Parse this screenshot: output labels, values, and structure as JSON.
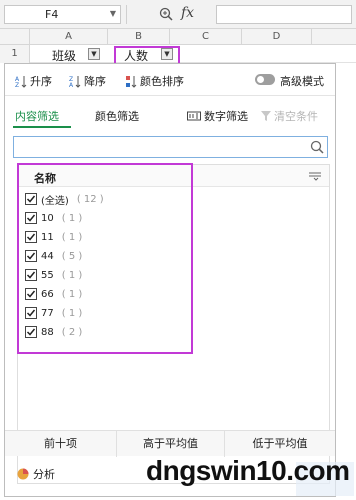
{
  "formula_bar": {
    "cell_ref": "F4",
    "fx": "fx"
  },
  "columns": [
    "A",
    "B",
    "C",
    "D"
  ],
  "row1": {
    "number": "1",
    "a": "班级",
    "b": "人数"
  },
  "sort": {
    "asc": "升序",
    "desc": "降序",
    "color_sort": "颜色排序",
    "advanced": "高级模式"
  },
  "tabs": {
    "content": "内容筛选",
    "color": "颜色筛选",
    "number": "数字筛选",
    "clear": "清空条件"
  },
  "search": {
    "placeholder": ""
  },
  "list": {
    "title": "名称",
    "items": [
      {
        "label": "(全选)",
        "count": "( 12 )",
        "checked": true
      },
      {
        "label": "10",
        "count": "( 1 )",
        "checked": true
      },
      {
        "label": "11",
        "count": "( 1 )",
        "checked": true
      },
      {
        "label": "44",
        "count": "( 5 )",
        "checked": true
      },
      {
        "label": "55",
        "count": "( 1 )",
        "checked": true
      },
      {
        "label": "66",
        "count": "( 1 )",
        "checked": true
      },
      {
        "label": "77",
        "count": "( 1 )",
        "checked": true
      },
      {
        "label": "88",
        "count": "( 2 )",
        "checked": true
      }
    ]
  },
  "bottom": {
    "top10": "前十项",
    "above_avg": "高于平均值",
    "below_avg": "低于平均值"
  },
  "analysis": "分析",
  "watermark": "dngswin10.com",
  "colors": {
    "accent_green": "#1a8f4a",
    "highlight": "#c239d6"
  }
}
